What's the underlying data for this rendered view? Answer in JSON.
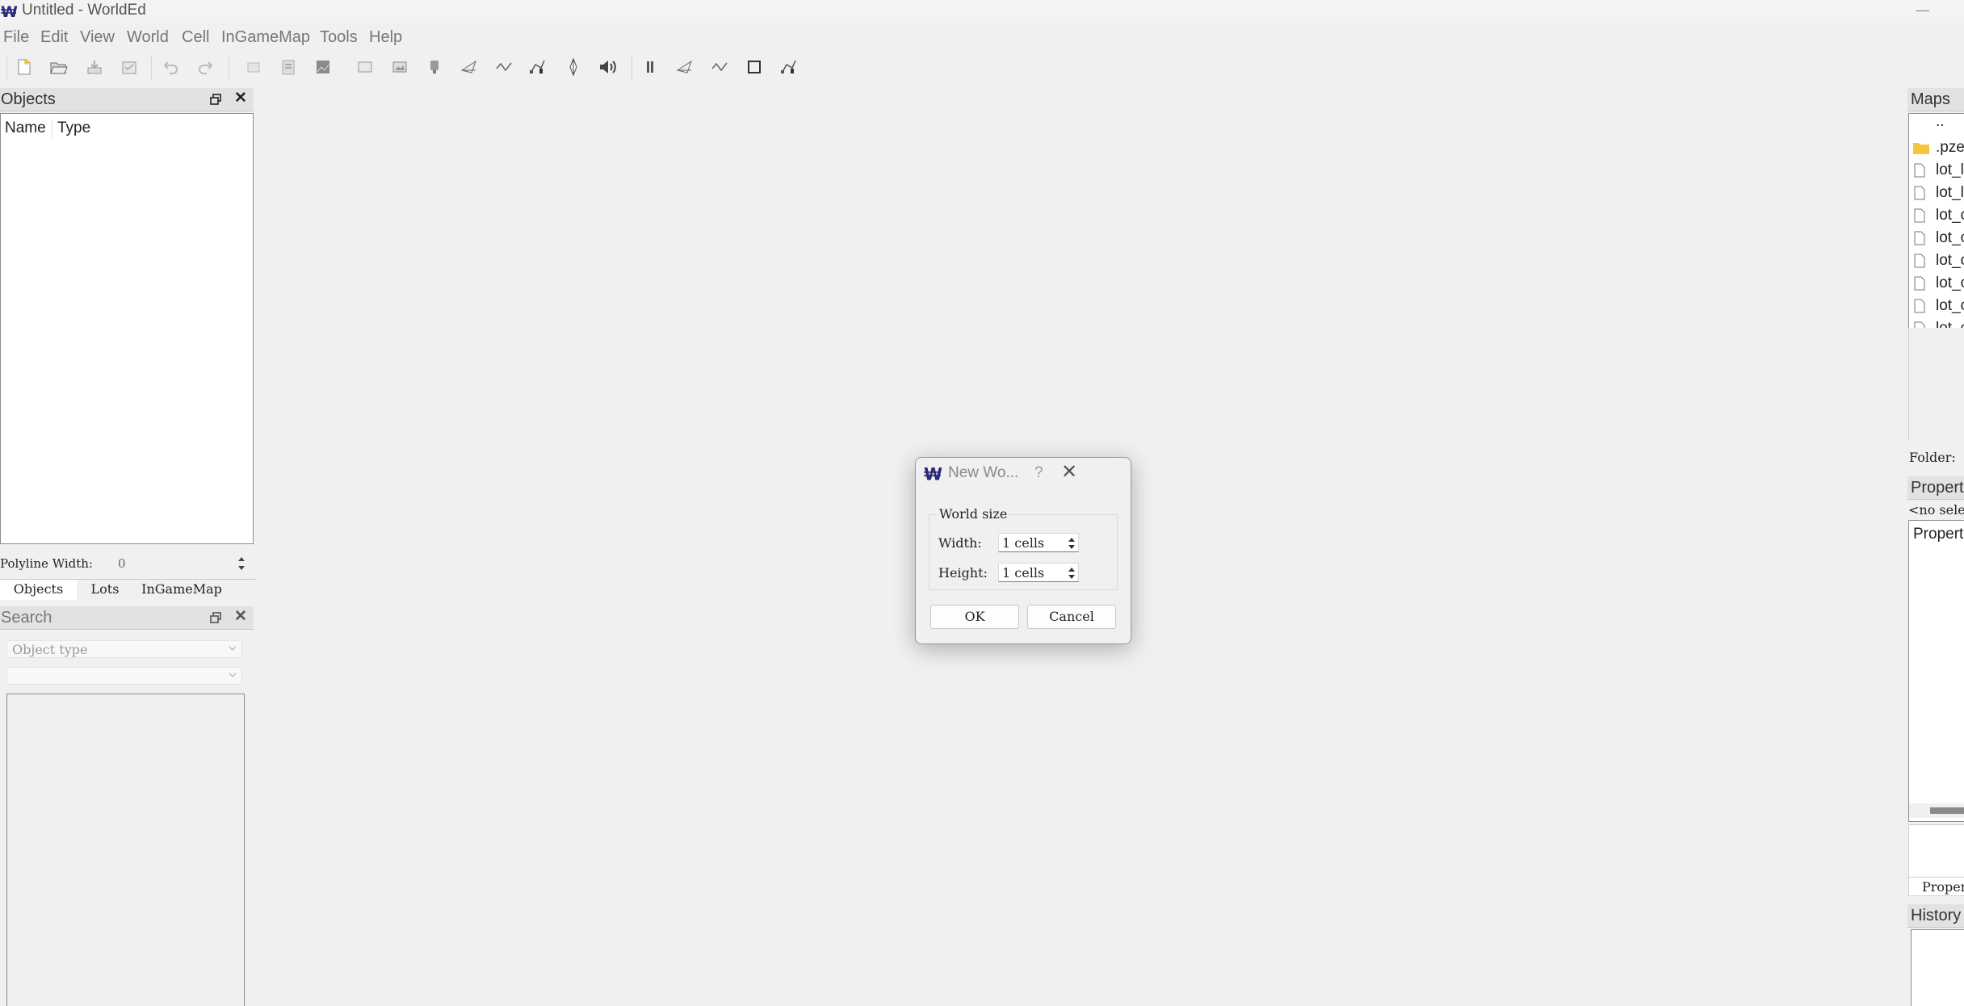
{
  "window": {
    "title": "Untitled - WorldEd",
    "app_icon": "worlded-logo-icon"
  },
  "menu": [
    "File",
    "Edit",
    "View",
    "World",
    "Cell",
    "InGameMap",
    "Tools",
    "Help"
  ],
  "toolbar": {
    "icons": [
      "new-icon",
      "open-icon",
      "save-icon",
      "save-as-icon",
      "undo-icon",
      "redo-icon",
      "cut-icon",
      "paste-icon",
      "picture-icon",
      "rectangle-icon",
      "image-icon",
      "lamp-icon",
      "flag-icon",
      "polyline-icon",
      "select-path-icon",
      "waypoint-icon",
      "sound-icon",
      "pause-icon",
      "flag2-icon",
      "polyline2-icon",
      "square-icon",
      "edit-path-icon"
    ]
  },
  "objects_panel": {
    "title": "Objects",
    "columns": [
      "Name",
      "Type"
    ],
    "polyline_label": "Polyline Width:",
    "polyline_value": "0",
    "tabs": [
      "Objects",
      "Lots",
      "InGameMap"
    ]
  },
  "search_panel": {
    "title": "Search",
    "object_type_placeholder": "Object type",
    "second_combo_value": ""
  },
  "maps_panel": {
    "title": "Maps",
    "files": [
      {
        "icon": "none",
        "name": ".."
      },
      {
        "icon": "folder-icon",
        "name": ".pze"
      },
      {
        "icon": "file-icon",
        "name": "lot_l"
      },
      {
        "icon": "file-icon",
        "name": "lot_l"
      },
      {
        "icon": "file-icon",
        "name": "lot_c"
      },
      {
        "icon": "file-icon",
        "name": "lot_c"
      },
      {
        "icon": "file-icon",
        "name": "lot_c"
      },
      {
        "icon": "file-icon",
        "name": "lot_c"
      },
      {
        "icon": "file-icon",
        "name": "lot_c"
      },
      {
        "icon": "file-icon",
        "name": "lot_c"
      }
    ],
    "folder_label": "Folder:"
  },
  "properties_panel": {
    "title": "Propert",
    "selection": "<no sele",
    "header": "Propert",
    "tab": "Proper"
  },
  "history_panel": {
    "title": "History"
  },
  "dialog": {
    "title": "New Wo...",
    "help": "?",
    "group_label": "World size",
    "width_label": "Width:",
    "width_value": "1 cells",
    "height_label": "Height:",
    "height_value": "1 cells",
    "ok": "OK",
    "cancel": "Cancel"
  },
  "colors": {
    "background": "#f0f0f0",
    "dock_title": "#e2e2e2",
    "folder": "#f5c542",
    "logo": "#2b2b7a"
  }
}
